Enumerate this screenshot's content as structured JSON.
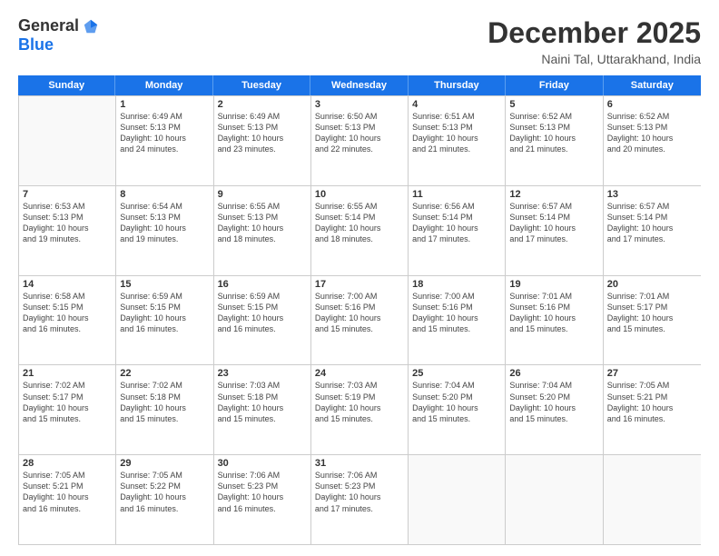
{
  "header": {
    "logo_general": "General",
    "logo_blue": "Blue",
    "title": "December 2025",
    "location": "Naini Tal, Uttarakhand, India"
  },
  "days_of_week": [
    "Sunday",
    "Monday",
    "Tuesday",
    "Wednesday",
    "Thursday",
    "Friday",
    "Saturday"
  ],
  "weeks": [
    [
      {
        "day": "",
        "lines": []
      },
      {
        "day": "1",
        "lines": [
          "Sunrise: 6:49 AM",
          "Sunset: 5:13 PM",
          "Daylight: 10 hours",
          "and 24 minutes."
        ]
      },
      {
        "day": "2",
        "lines": [
          "Sunrise: 6:49 AM",
          "Sunset: 5:13 PM",
          "Daylight: 10 hours",
          "and 23 minutes."
        ]
      },
      {
        "day": "3",
        "lines": [
          "Sunrise: 6:50 AM",
          "Sunset: 5:13 PM",
          "Daylight: 10 hours",
          "and 22 minutes."
        ]
      },
      {
        "day": "4",
        "lines": [
          "Sunrise: 6:51 AM",
          "Sunset: 5:13 PM",
          "Daylight: 10 hours",
          "and 21 minutes."
        ]
      },
      {
        "day": "5",
        "lines": [
          "Sunrise: 6:52 AM",
          "Sunset: 5:13 PM",
          "Daylight: 10 hours",
          "and 21 minutes."
        ]
      },
      {
        "day": "6",
        "lines": [
          "Sunrise: 6:52 AM",
          "Sunset: 5:13 PM",
          "Daylight: 10 hours",
          "and 20 minutes."
        ]
      }
    ],
    [
      {
        "day": "7",
        "lines": [
          "Sunrise: 6:53 AM",
          "Sunset: 5:13 PM",
          "Daylight: 10 hours",
          "and 19 minutes."
        ]
      },
      {
        "day": "8",
        "lines": [
          "Sunrise: 6:54 AM",
          "Sunset: 5:13 PM",
          "Daylight: 10 hours",
          "and 19 minutes."
        ]
      },
      {
        "day": "9",
        "lines": [
          "Sunrise: 6:55 AM",
          "Sunset: 5:13 PM",
          "Daylight: 10 hours",
          "and 18 minutes."
        ]
      },
      {
        "day": "10",
        "lines": [
          "Sunrise: 6:55 AM",
          "Sunset: 5:14 PM",
          "Daylight: 10 hours",
          "and 18 minutes."
        ]
      },
      {
        "day": "11",
        "lines": [
          "Sunrise: 6:56 AM",
          "Sunset: 5:14 PM",
          "Daylight: 10 hours",
          "and 17 minutes."
        ]
      },
      {
        "day": "12",
        "lines": [
          "Sunrise: 6:57 AM",
          "Sunset: 5:14 PM",
          "Daylight: 10 hours",
          "and 17 minutes."
        ]
      },
      {
        "day": "13",
        "lines": [
          "Sunrise: 6:57 AM",
          "Sunset: 5:14 PM",
          "Daylight: 10 hours",
          "and 17 minutes."
        ]
      }
    ],
    [
      {
        "day": "14",
        "lines": [
          "Sunrise: 6:58 AM",
          "Sunset: 5:15 PM",
          "Daylight: 10 hours",
          "and 16 minutes."
        ]
      },
      {
        "day": "15",
        "lines": [
          "Sunrise: 6:59 AM",
          "Sunset: 5:15 PM",
          "Daylight: 10 hours",
          "and 16 minutes."
        ]
      },
      {
        "day": "16",
        "lines": [
          "Sunrise: 6:59 AM",
          "Sunset: 5:15 PM",
          "Daylight: 10 hours",
          "and 16 minutes."
        ]
      },
      {
        "day": "17",
        "lines": [
          "Sunrise: 7:00 AM",
          "Sunset: 5:16 PM",
          "Daylight: 10 hours",
          "and 15 minutes."
        ]
      },
      {
        "day": "18",
        "lines": [
          "Sunrise: 7:00 AM",
          "Sunset: 5:16 PM",
          "Daylight: 10 hours",
          "and 15 minutes."
        ]
      },
      {
        "day": "19",
        "lines": [
          "Sunrise: 7:01 AM",
          "Sunset: 5:16 PM",
          "Daylight: 10 hours",
          "and 15 minutes."
        ]
      },
      {
        "day": "20",
        "lines": [
          "Sunrise: 7:01 AM",
          "Sunset: 5:17 PM",
          "Daylight: 10 hours",
          "and 15 minutes."
        ]
      }
    ],
    [
      {
        "day": "21",
        "lines": [
          "Sunrise: 7:02 AM",
          "Sunset: 5:17 PM",
          "Daylight: 10 hours",
          "and 15 minutes."
        ]
      },
      {
        "day": "22",
        "lines": [
          "Sunrise: 7:02 AM",
          "Sunset: 5:18 PM",
          "Daylight: 10 hours",
          "and 15 minutes."
        ]
      },
      {
        "day": "23",
        "lines": [
          "Sunrise: 7:03 AM",
          "Sunset: 5:18 PM",
          "Daylight: 10 hours",
          "and 15 minutes."
        ]
      },
      {
        "day": "24",
        "lines": [
          "Sunrise: 7:03 AM",
          "Sunset: 5:19 PM",
          "Daylight: 10 hours",
          "and 15 minutes."
        ]
      },
      {
        "day": "25",
        "lines": [
          "Sunrise: 7:04 AM",
          "Sunset: 5:20 PM",
          "Daylight: 10 hours",
          "and 15 minutes."
        ]
      },
      {
        "day": "26",
        "lines": [
          "Sunrise: 7:04 AM",
          "Sunset: 5:20 PM",
          "Daylight: 10 hours",
          "and 15 minutes."
        ]
      },
      {
        "day": "27",
        "lines": [
          "Sunrise: 7:05 AM",
          "Sunset: 5:21 PM",
          "Daylight: 10 hours",
          "and 16 minutes."
        ]
      }
    ],
    [
      {
        "day": "28",
        "lines": [
          "Sunrise: 7:05 AM",
          "Sunset: 5:21 PM",
          "Daylight: 10 hours",
          "and 16 minutes."
        ]
      },
      {
        "day": "29",
        "lines": [
          "Sunrise: 7:05 AM",
          "Sunset: 5:22 PM",
          "Daylight: 10 hours",
          "and 16 minutes."
        ]
      },
      {
        "day": "30",
        "lines": [
          "Sunrise: 7:06 AM",
          "Sunset: 5:23 PM",
          "Daylight: 10 hours",
          "and 16 minutes."
        ]
      },
      {
        "day": "31",
        "lines": [
          "Sunrise: 7:06 AM",
          "Sunset: 5:23 PM",
          "Daylight: 10 hours",
          "and 17 minutes."
        ]
      },
      {
        "day": "",
        "lines": []
      },
      {
        "day": "",
        "lines": []
      },
      {
        "day": "",
        "lines": []
      }
    ]
  ]
}
